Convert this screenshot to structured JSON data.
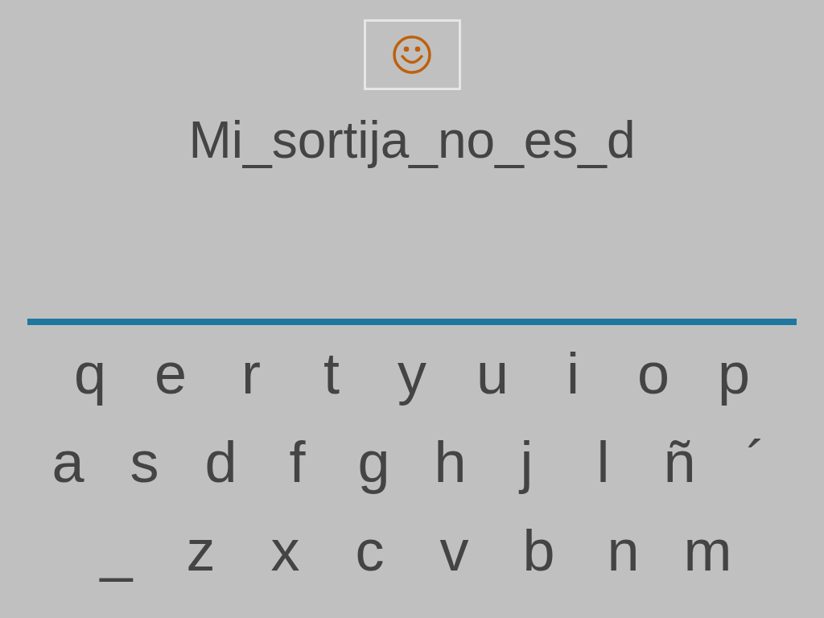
{
  "phrase": "Mi_sortija_no_es_d",
  "keyboard": [
    [
      "q",
      "e",
      "r",
      "t",
      "y",
      "u",
      "i",
      "o",
      "p"
    ],
    [
      "a",
      "s",
      "d",
      "f",
      "g",
      "h",
      "j",
      "l",
      "ñ",
      "´"
    ],
    [
      "_",
      "z",
      "x",
      "c",
      "v",
      "b",
      "n",
      "m"
    ]
  ]
}
